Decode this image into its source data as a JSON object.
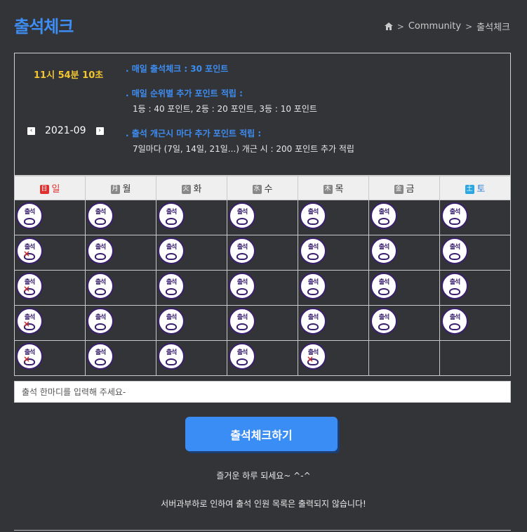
{
  "header": {
    "title": "출석체크",
    "breadcrumb": [
      "Community",
      "출석체크"
    ]
  },
  "info": {
    "clock": "11시 54분 10초",
    "month": "2021-09",
    "prev_label": "‹",
    "next_label": "›",
    "rules": [
      {
        "title": ". 매일 출석체크 : 30 포인트",
        "detail": ""
      },
      {
        "title": ". 매일 순위별 추가 포인트 적립 :",
        "detail": "1등 : 40 포인트,   2등 : 20 포인트,   3등 : 10 포인트"
      },
      {
        "title": ". 출석 개근시 마다 추가 포인트 적립 :",
        "detail": "7일마다 (7일, 14일, 21일...) 개근 시 : 200 포인트 추가 적립"
      }
    ]
  },
  "calendar": {
    "days": [
      {
        "icon": "日",
        "label": "일"
      },
      {
        "icon": "月",
        "label": "월"
      },
      {
        "icon": "火",
        "label": "화"
      },
      {
        "icon": "水",
        "label": "수"
      },
      {
        "icon": "木",
        "label": "목"
      },
      {
        "icon": "金",
        "label": "금"
      },
      {
        "icon": "土",
        "label": "토"
      }
    ],
    "stamp_text": "출석",
    "weeks": [
      [
        1,
        1,
        1,
        1,
        1,
        1,
        1
      ],
      [
        2,
        1,
        1,
        1,
        1,
        1,
        1
      ],
      [
        2,
        1,
        1,
        1,
        1,
        1,
        1
      ],
      [
        2,
        1,
        1,
        1,
        1,
        1,
        1
      ],
      [
        2,
        1,
        1,
        1,
        2,
        0,
        0
      ]
    ]
  },
  "comment": {
    "placeholder": "출석 한마디를 입력해 주세요-"
  },
  "submit_label": "출석체크하기",
  "greeting": "즐거운 하루 되세요~ ^-^",
  "notice": "서버과부하로 인하여 출석 인원 목록은 출력되지 않습니다!"
}
